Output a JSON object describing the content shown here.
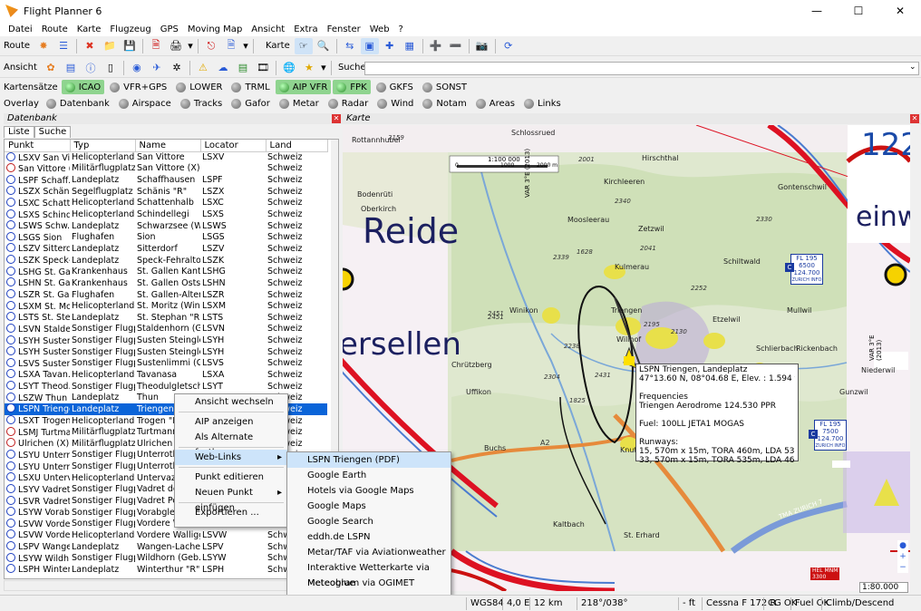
{
  "app": {
    "title": "Flight Planner 6"
  },
  "menu": [
    "Datei",
    "Route",
    "Karte",
    "Flugzeug",
    "GPS",
    "Moving Map",
    "Ansicht",
    "Extra",
    "Fenster",
    "Web",
    "?"
  ],
  "toolbar1": {
    "route_label": "Route",
    "karte_label": "Karte"
  },
  "toolbar2": {
    "ansicht_label": "Ansicht",
    "suche_label": "Suche",
    "search_value": ""
  },
  "kartensaetze": {
    "label": "Kartensätze",
    "items": [
      {
        "label": "ICAO",
        "on": true
      },
      {
        "label": "VFR+GPS",
        "on": false
      },
      {
        "label": "LOWER",
        "on": false
      },
      {
        "label": "TRML",
        "on": false
      },
      {
        "label": "AIP VFR",
        "on": true
      },
      {
        "label": "FPK",
        "on": true
      },
      {
        "label": "GKFS",
        "on": false
      },
      {
        "label": "SONST",
        "on": false
      }
    ]
  },
  "overlay": {
    "label": "Overlay",
    "items": [
      "Datenbank",
      "Airspace",
      "Tracks",
      "Gafor",
      "Metar",
      "Radar",
      "Wind",
      "Notam",
      "Areas",
      "Links"
    ]
  },
  "datenbank": {
    "panel_title": "Datenbank",
    "tabs": [
      "Liste",
      "Suche"
    ],
    "columns": [
      "Punkt",
      "Typ",
      "Name",
      "Locator",
      "Land"
    ],
    "rows": [
      [
        "LSXV San Vit...",
        "Helicopterlande...",
        "San Vittore",
        "LSXV",
        "Schweiz"
      ],
      [
        "San Vittore (X)",
        "Militärflugplatz",
        "San Vittore (X)",
        "",
        "Schweiz"
      ],
      [
        "LSPF Schaff...",
        "Landeplatz",
        "Schaffhausen",
        "LSPF",
        "Schweiz"
      ],
      [
        "LSZX Schäni...",
        "Segelflugplatz",
        "Schänis \"R\"",
        "LSZX",
        "Schweiz"
      ],
      [
        "LSXC Schatt...",
        "Helicopterlande...",
        "Schattenhalb",
        "LSXC",
        "Schweiz"
      ],
      [
        "LSXS Schind...",
        "Helicopterlande...",
        "Schindellegi",
        "LSXS",
        "Schweiz"
      ],
      [
        "LSWS Schw...",
        "Landeplatz",
        "Schwarzsee (W...",
        "LSWS",
        "Schweiz"
      ],
      [
        "LSGS Sion",
        "Flughafen",
        "Sion",
        "LSGS",
        "Schweiz"
      ],
      [
        "LSZV Sitterdorf",
        "Landeplatz",
        "Sitterdorf",
        "LSZV",
        "Schweiz"
      ],
      [
        "LSZK Speck-...",
        "Landeplatz",
        "Speck-Fehraltorf",
        "LSZK",
        "Schweiz"
      ],
      [
        "LSHG St. Gal...",
        "Krankenhaus",
        "St. Gallen Kant...",
        "LSHG",
        "Schweiz"
      ],
      [
        "LSHN St. Gal...",
        "Krankenhaus",
        "St. Gallen Osts...",
        "LSHN",
        "Schweiz"
      ],
      [
        "LSZR St. Gal...",
        "Flughafen",
        "St. Gallen-Alten...",
        "LSZR",
        "Schweiz"
      ],
      [
        "LSXM St. Mo...",
        "Helicopterlande...",
        "St. Moritz (Wint...",
        "LSXM",
        "Schweiz"
      ],
      [
        "LSTS St. Ste...",
        "Landeplatz",
        "St. Stephan \"R\"",
        "LSTS",
        "Schweiz"
      ],
      [
        "LSVN Stalde...",
        "Sonstiger Flugpl...",
        "Staldenhorn (G...",
        "LSVN",
        "Schweiz"
      ],
      [
        "LSYH Susten...",
        "Sonstiger Flugpl...",
        "Susten Steingle...",
        "LSYH",
        "Schweiz"
      ],
      [
        "LSYH Susten...",
        "Sonstiger Flugpl...",
        "Susten Steingle...",
        "LSYH",
        "Schweiz"
      ],
      [
        "LSVS Sustenl...",
        "Sonstiger Flugpl...",
        "Sustenlimmi (Ge...",
        "LSVS",
        "Schweiz"
      ],
      [
        "LSXA Tavan...",
        "Helicopterlande...",
        "Tavanasa",
        "LSXA",
        "Schweiz"
      ],
      [
        "LSYT Theod...",
        "Sonstiger Flugpl...",
        "Theodulgletsch...",
        "LSYT",
        "Schweiz"
      ],
      [
        "LSZW Thun",
        "Landeplatz",
        "Thun",
        "",
        "Schweiz"
      ],
      [
        "LSPN Triengen",
        "Landeplatz",
        "Triengen",
        "",
        "Schweiz"
      ],
      [
        "LSXT Trogen...",
        "Helicopterlande...",
        "Trogen \"R\"",
        "",
        "Schweiz"
      ],
      [
        "LSMJ Turtma...",
        "Militärflugplatz",
        "Turtmann V...",
        "",
        "Schweiz"
      ],
      [
        "Ulrichen (X)",
        "Militärflugplatz",
        "Ulrichen (X)",
        "",
        "Schweiz"
      ],
      [
        "LSYU Unterr...",
        "Sonstiger Flugpl...",
        "Unterrothor...",
        "",
        "Schweiz"
      ],
      [
        "LSYU Unterr...",
        "Sonstiger Flugpl...",
        "Unterrothor...",
        "",
        "Schweiz"
      ],
      [
        "LSXU Untervaz",
        "Helicopterlande...",
        "Untervaz",
        "",
        "Schweiz"
      ],
      [
        "LSYV Vadret ...",
        "Sonstiger Flugpl...",
        "Vadret del T...",
        "",
        "Schweiz"
      ],
      [
        "LSVR Vadret ...",
        "Sonstiger Flugpl...",
        "Vadret Pers...",
        "",
        "Schweiz"
      ],
      [
        "LSYW Vorab...",
        "Sonstiger Flugpl...",
        "Vorabgletsc...",
        "",
        "Schweiz"
      ],
      [
        "LSVW Vorder...",
        "Sonstiger Flugpl...",
        "Vordere Wa...",
        "",
        "Schweiz"
      ],
      [
        "LSVW Vorder...",
        "Helicopterlande...",
        "Vordere Walligg...",
        "LSVW",
        "Schweiz"
      ],
      [
        "LSPV Wange...",
        "Landeplatz",
        "Wangen-Lachen",
        "LSPV",
        "Schweiz"
      ],
      [
        "LSYW Wildh...",
        "Sonstiger Flugpl...",
        "Wildhorn (Geb...",
        "LSYW",
        "Schweiz"
      ],
      [
        "LSPH Winter...",
        "Landeplatz",
        "Winterthur \"R\"",
        "LSPH",
        "Schweiz"
      ]
    ],
    "selected_index": 22,
    "military_rows": [
      1,
      24,
      25
    ]
  },
  "karte": {
    "panel_title": "Karte",
    "scale_label": "1:100 000",
    "scale_ticks": [
      "0",
      "1000",
      "2000 m"
    ],
    "zoom": "1:80.000"
  },
  "context_menu": {
    "items": [
      "Ansicht wechseln",
      "AIP anzeigen",
      "Als Alternate festlegen",
      "Web-Links",
      "Punkt editieren",
      "Neuen Punkt einfügen",
      "Exportieren ..."
    ],
    "highlighted": "Web-Links"
  },
  "weblinks_menu": {
    "items": [
      "LSPN Triengen (PDF)",
      "Google Earth",
      "Hotels via Google Maps",
      "Google Maps",
      "Google Search",
      "eddh.de LSPN",
      "Metar/TAF via Aviationweather",
      "Interaktive Wetterkarte via Meteoblue",
      "Meteogram via OGIMET",
      "Open Topomaps"
    ],
    "highlighted": "LSPN Triengen (PDF)"
  },
  "tooltip": {
    "lines": [
      "LSPN Triengen, Landeplatz",
      "47°13.60 N, 08°04.68 E, Elev. : 1.594 ft",
      "",
      "Frequencies",
      "Triengen Aerodrome 124.530 PPR",
      "",
      "Fuel: 100LL JETA1 MOGAS",
      "",
      "Runways:",
      "15, 570m x 15m, TORA 460m, LDA 535m, Asphalt",
      "33, 570m x 15m, TORA 535m, LDA 460m, Asphalt"
    ]
  },
  "map_labels": {
    "places": [
      "Rottannhubel",
      "Schlossrued",
      "Hirschthal",
      "Bodenrüti",
      "Oberkirch",
      "Kirchleeren",
      "Gontenschwil",
      "Moosleerau",
      "Zetzwil",
      "Kulmerau",
      "Schiltwald",
      "Winikon",
      "Triengen",
      "Etzelwil",
      "Mullwil",
      "Wilihof",
      "Schlierbach",
      "Rickenbach",
      "Chrützberg",
      "Uffikon",
      "Niederwil",
      "Buchs",
      "Knutwil",
      "Kaltbach",
      "St. Erhard",
      "Gunzwil",
      "Dagmersellen"
    ],
    "spot_heights": [
      "2159",
      "2001",
      "2451",
      "2340",
      "2041",
      "2330",
      "2339",
      "1628",
      "2451",
      "2304",
      "1825",
      "2252",
      "2130",
      "2431",
      "2238",
      "2195",
      "2390"
    ],
    "big_text": [
      "Reide",
      "ersellen",
      "122",
      "einw"
    ],
    "airspace_boxes": [
      {
        "fl": "FL 195",
        "alt": "6500",
        "freq": "124.700",
        "name": "ZURICH INFO",
        "x": "C"
      },
      {
        "fl": "FL 195",
        "alt": "7500",
        "freq": "124.700",
        "name": "ZURICH INFO",
        "x": "C"
      }
    ],
    "vertical_labels": [
      "VAR 3°E (2013)",
      "VAR 3°E (2013)"
    ],
    "roads": [
      "A2",
      "TMA ZURICH 7"
    ],
    "hel_label": "HEL MNM",
    "hel_val": "3300"
  },
  "statusbar": {
    "fields": [
      "WGS84",
      "4,0 E",
      "12 km",
      "218°/038°",
      "- ft",
      "Cessna F 172 R",
      "CG OK",
      "Fuel OK",
      "Climb/Descend"
    ]
  }
}
